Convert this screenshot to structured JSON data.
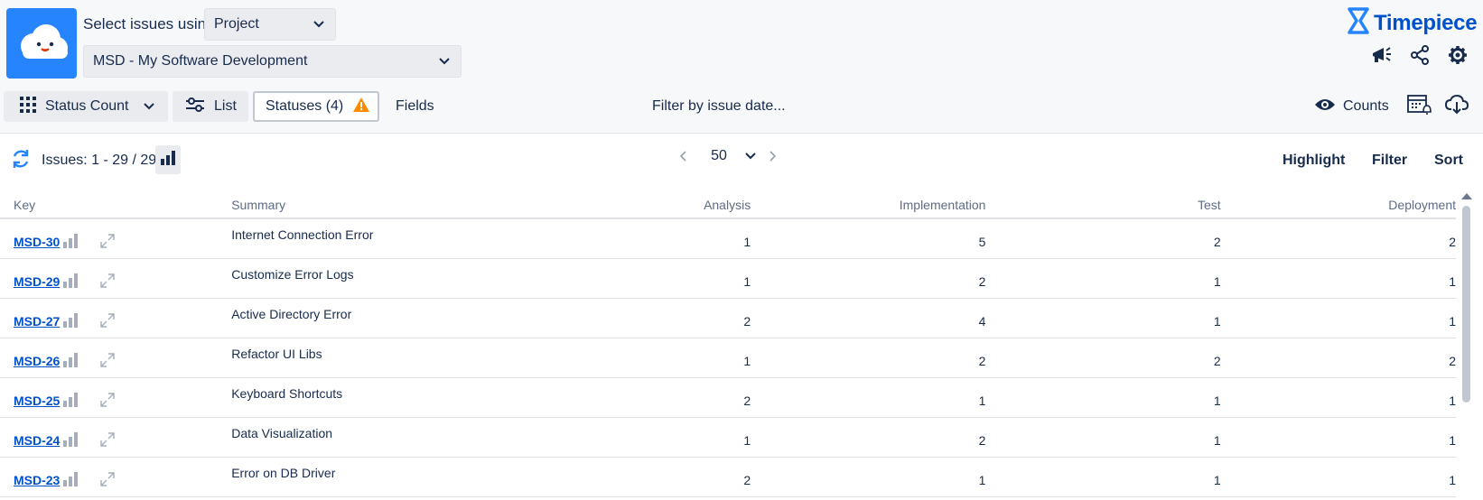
{
  "header": {
    "select_label": "Select issues using",
    "project_select": "Project",
    "project_value": "MSD - My Software Development",
    "brand_name": "Timepiece",
    "brand_color": "#0052cc"
  },
  "toolbar": {
    "status_count_label": "Status Count",
    "list_label": "List",
    "statuses_label": "Statuses (4)",
    "fields_label": "Fields",
    "filter_date_label": "Filter by issue date...",
    "counts_label": "Counts",
    "warning_color": "#ff8b00"
  },
  "issues_bar": {
    "count_text": "Issues: 1 - 29 / 29",
    "page_size": "50",
    "highlight_label": "Highlight",
    "filter_label": "Filter",
    "sort_label": "Sort"
  },
  "table": {
    "headers": {
      "key": "Key",
      "summary": "Summary",
      "analysis": "Analysis",
      "implementation": "Implementation",
      "test": "Test",
      "deployment": "Deployment"
    },
    "rows": [
      {
        "key": "MSD-30",
        "summary": "Internet Connection Error",
        "analysis": "1",
        "implementation": "5",
        "test": "2",
        "deployment": "2"
      },
      {
        "key": "MSD-29",
        "summary": "Customize Error Logs",
        "analysis": "1",
        "implementation": "2",
        "test": "1",
        "deployment": "1"
      },
      {
        "key": "MSD-27",
        "summary": "Active Directory Error",
        "analysis": "2",
        "implementation": "4",
        "test": "1",
        "deployment": "1"
      },
      {
        "key": "MSD-26",
        "summary": "Refactor UI Libs",
        "analysis": "1",
        "implementation": "2",
        "test": "2",
        "deployment": "2"
      },
      {
        "key": "MSD-25",
        "summary": "Keyboard Shortcuts",
        "analysis": "2",
        "implementation": "1",
        "test": "1",
        "deployment": "1"
      },
      {
        "key": "MSD-24",
        "summary": "Data Visualization",
        "analysis": "1",
        "implementation": "2",
        "test": "1",
        "deployment": "1"
      },
      {
        "key": "MSD-23",
        "summary": "Error on DB Driver",
        "analysis": "2",
        "implementation": "1",
        "test": "1",
        "deployment": "1"
      }
    ]
  }
}
